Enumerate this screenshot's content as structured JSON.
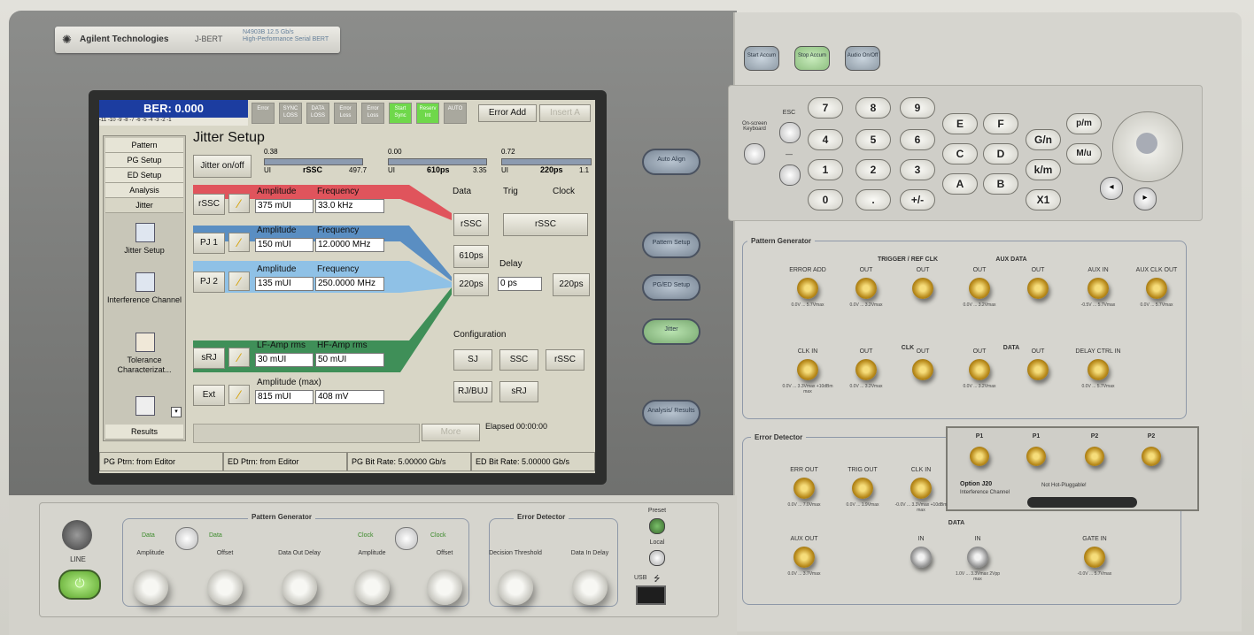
{
  "brand": {
    "company": "Agilent Technologies",
    "product": "J-BERT",
    "model": "N4903B",
    "model_sub": "High-Performance Serial BERT",
    "model_range": "12.5 Gb/s"
  },
  "screen": {
    "ber": "BER: 0.000",
    "ber_scale": "-11 -10 -9 -8 -7 -6 -5 -4 -3 -2 -1",
    "indicators": [
      {
        "label": "Error",
        "on": false
      },
      {
        "label": "SYNC LOSS",
        "on": false
      },
      {
        "label": "DATA LOSS",
        "on": false
      },
      {
        "label": "Error Loss",
        "on": false
      },
      {
        "label": "Error Loss",
        "on": false
      },
      {
        "label": "Start Sync",
        "on": true
      },
      {
        "label": "Reserv Int",
        "on": true
      },
      {
        "label": "AUTO",
        "on": false
      }
    ],
    "error_add": "Error Add",
    "insert": "Insert A",
    "nav": {
      "tabs": [
        "Pattern",
        "PG Setup",
        "ED Setup",
        "Analysis",
        "Jitter"
      ],
      "items": [
        {
          "label": "Jitter Setup"
        },
        {
          "label": "Interference Channel"
        },
        {
          "label": "Tolerance Characterizat..."
        },
        {
          "label": ""
        }
      ],
      "results": "Results"
    },
    "title": "Jitter Setup",
    "jitter_onoff": "Jitter on/off",
    "meters": [
      {
        "top": "0.38",
        "left": "UI",
        "name": "rSSC",
        "right": "497.7"
      },
      {
        "top": "0.00",
        "left": "UI",
        "name": "610ps",
        "right": "3.35"
      },
      {
        "top": "0.72",
        "left": "UI",
        "name": "220ps",
        "right": "1.1"
      }
    ],
    "rows": [
      {
        "btn": "rSSC",
        "lab1": "Amplitude",
        "val1": "375 mUI",
        "lab2": "Frequency",
        "val2": "33.0 kHz",
        "color": "#e0545c"
      },
      {
        "btn": "PJ 1",
        "lab1": "Amplitude",
        "val1": "150 mUI",
        "lab2": "Frequency",
        "val2": "12.0000 MHz",
        "color": "#5a8ec2"
      },
      {
        "btn": "PJ 2",
        "lab1": "Amplitude",
        "val1": "135 mUI",
        "lab2": "Frequency",
        "val2": "250.0000 MHz",
        "color": "#8fc1e6"
      },
      {
        "btn": "sRJ",
        "lab1": "LF-Amp rms",
        "val1": "30 mUI",
        "lab2": "HF-Amp rms",
        "val2": "50 mUI",
        "color": "#3f8f58"
      },
      {
        "btn": "Ext",
        "lab1": "Amplitude (max)",
        "val1": "815 mUI",
        "lab2": "",
        "val2": "408 mV",
        "color": ""
      }
    ],
    "cols": {
      "data": "Data",
      "trig": "Trig",
      "clock": "Clock"
    },
    "data_btns": [
      "rSSC",
      "610ps",
      "220ps"
    ],
    "clock_btns": [
      "rSSC",
      "220ps"
    ],
    "delay_label": "Delay",
    "delay_value": "0 ps",
    "config_label": "Configuration",
    "config_btns": [
      "SJ",
      "SSC",
      "rSSC",
      "RJ/BUJ",
      "sRJ"
    ],
    "more": "More",
    "elapsed": "Elapsed 00:00:00",
    "status": [
      "PG Ptrn: from Editor",
      "ED Ptrn: from Editor",
      "PG Bit Rate: 5.00000 Gb/s",
      "ED Bit Rate: 5.00000 Gb/s"
    ]
  },
  "side_buttons": [
    "Auto Align",
    "Pattern Setup",
    "PG/ED Setup",
    "Jitter",
    "Analysis/ Results"
  ],
  "top_buttons": [
    "Start Accum",
    "Stop Accum",
    "Audio On/Off"
  ],
  "keypad": {
    "onscreen": "On-screen Keyboard",
    "esc": "ESC",
    "minus": "—",
    "digits": [
      "7",
      "8",
      "9",
      "4",
      "5",
      "6",
      "1",
      "2",
      "3",
      "0",
      ".",
      "+/-"
    ],
    "hex": [
      "E",
      "F",
      "C",
      "D",
      "A",
      "B"
    ],
    "units": [
      "G/n",
      "k/m",
      "X1"
    ],
    "more_units": [
      "p/m",
      "M/u"
    ]
  },
  "pattern_generator": {
    "title": "Pattern Generator",
    "connectors": [
      {
        "label": "ERROR ADD",
        "spec": "0.0V ... 5.7Vmax"
      },
      {
        "label": "OUT",
        "spec": "0.0V ... 3.2Vmax"
      },
      {
        "label": "OUT",
        "spec": ""
      },
      {
        "label": "OUT",
        "spec": "0.0V ... 3.2Vmax"
      },
      {
        "label": "OUT",
        "spec": ""
      },
      {
        "label": "AUX IN",
        "spec": "-0.5V ... 5.7Vmax"
      },
      {
        "label": "AUX CLK OUT",
        "spec": "0.0V ... 5.7Vmax"
      },
      {
        "label": "CLK IN",
        "spec": "0.0V ... 3.3Vmax +10dBm max"
      },
      {
        "label": "OUT",
        "spec": "0.0V ... 3.2Vmax"
      },
      {
        "label": "OUT",
        "spec": ""
      },
      {
        "label": "OUT",
        "spec": "0.0V ... 3.2Vmax"
      },
      {
        "label": "OUT",
        "spec": ""
      },
      {
        "label": "DELAY CTRL IN",
        "spec": "0.0V ... 5.7Vmax"
      }
    ],
    "groups": [
      "TRIGGER / REF CLK",
      "AUX DATA",
      "CLK",
      "DATA"
    ]
  },
  "error_detector": {
    "title": "Error Detector",
    "connectors": [
      {
        "label": "ERR OUT",
        "spec": "0.0V ... 7.0Vmax"
      },
      {
        "label": "TRIG OUT",
        "spec": "0.0V ... 1.9Vmax"
      },
      {
        "label": "CLK IN",
        "spec": "-0.0V ... 3.3Vmax +10dBm max"
      },
      {
        "label": "AUX OUT",
        "spec": "0.0V ... 3.7Vmax"
      },
      {
        "label": "IN",
        "spec": ""
      },
      {
        "label": "IN",
        "spec": "1.0V ... 3.3Vmax 2Vpp max"
      },
      {
        "label": "GATE IN",
        "spec": "-0.0V ... 5.7Vmax"
      }
    ],
    "data_group": "DATA"
  },
  "option": {
    "labels": [
      "P1",
      "P1",
      "P2",
      "P2"
    ],
    "title": "Option J20",
    "subtitle": "Interference Channel",
    "note": "Not Hot-Pluggable!"
  },
  "bottom": {
    "line": "LINE",
    "pattern_generator": "Pattern Generator",
    "error_detector": "Error Detector",
    "preset": "Preset",
    "local": "Local",
    "usb": "USB",
    "pg_tags": [
      "Data",
      "Data",
      "Clock",
      "Clock"
    ],
    "knobs": [
      "Amplitude",
      "Offset",
      "Data Out Delay",
      "Amplitude",
      "Offset",
      "Decision Threshold",
      "Data In Delay"
    ]
  }
}
